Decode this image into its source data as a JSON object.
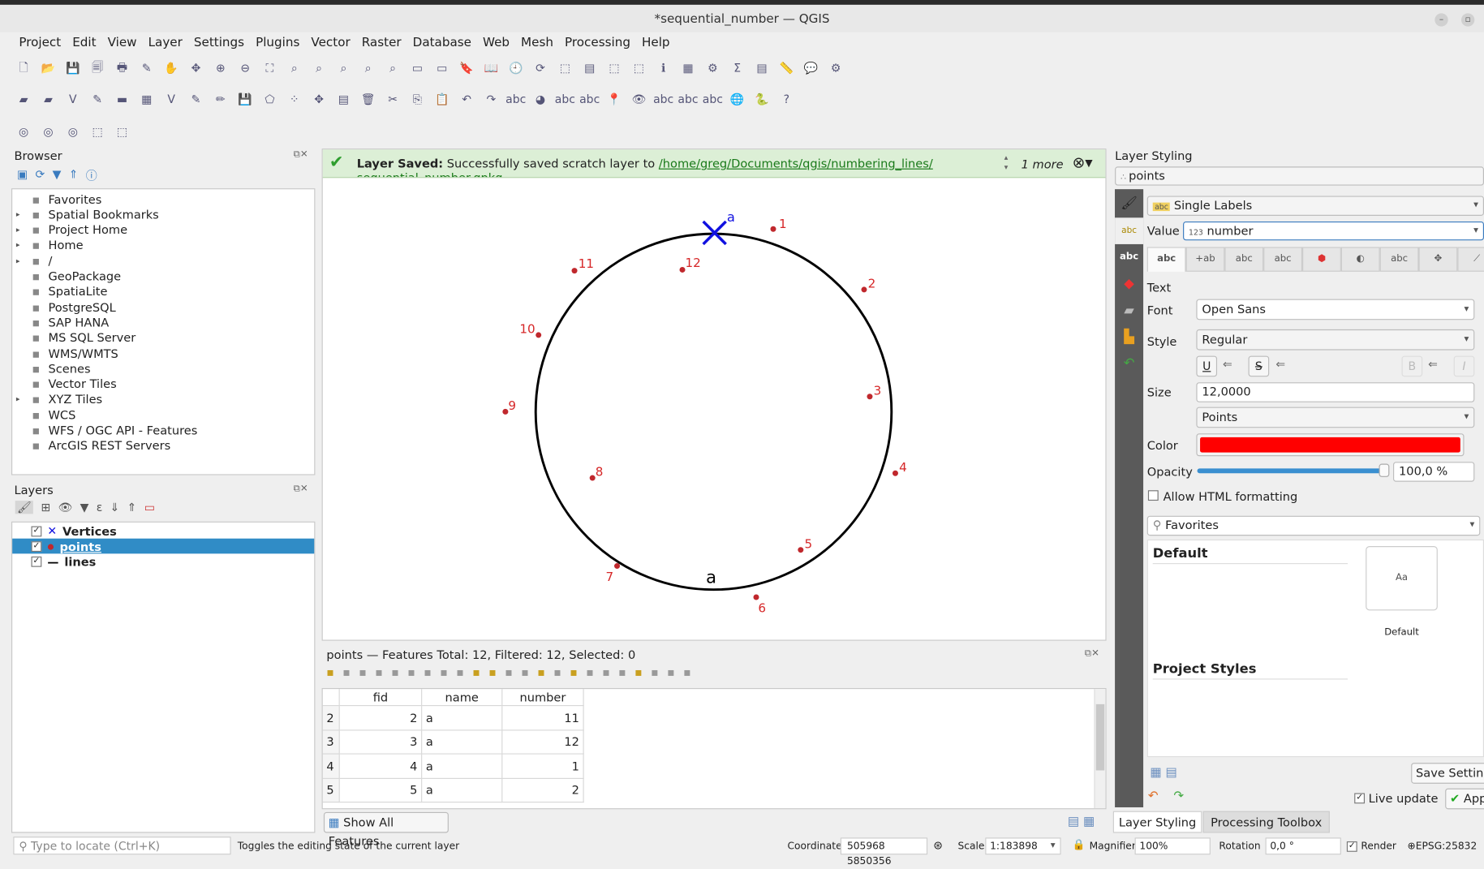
{
  "window": {
    "title": "*sequential_number — QGIS"
  },
  "menu": [
    "Project",
    "Edit",
    "View",
    "Layer",
    "Settings",
    "Plugins",
    "Vector",
    "Raster",
    "Database",
    "Web",
    "Mesh",
    "Processing",
    "Help"
  ],
  "browser": {
    "title": "Browser",
    "items": [
      {
        "label": "Favorites",
        "icon": "star-icon",
        "expandable": false
      },
      {
        "label": "Spatial Bookmarks",
        "icon": "bookmark-icon",
        "expandable": true
      },
      {
        "label": "Project Home",
        "icon": "folder-icon",
        "expandable": true
      },
      {
        "label": "Home",
        "icon": "home-icon",
        "expandable": true
      },
      {
        "label": "/",
        "icon": "folder-icon",
        "expandable": true
      },
      {
        "label": "GeoPackage",
        "icon": "geopackage-icon",
        "expandable": false
      },
      {
        "label": "SpatiaLite",
        "icon": "spatialite-icon",
        "expandable": false
      },
      {
        "label": "PostgreSQL",
        "icon": "postgresql-icon",
        "expandable": false
      },
      {
        "label": "SAP HANA",
        "icon": "hana-icon",
        "expandable": false
      },
      {
        "label": "MS SQL Server",
        "icon": "mssql-icon",
        "expandable": false
      },
      {
        "label": "WMS/WMTS",
        "icon": "globe-icon",
        "expandable": false
      },
      {
        "label": "Scenes",
        "icon": "scenes-icon",
        "expandable": false
      },
      {
        "label": "Vector Tiles",
        "icon": "grid-icon",
        "expandable": false
      },
      {
        "label": "XYZ Tiles",
        "icon": "grid-icon",
        "expandable": true
      },
      {
        "label": "WCS",
        "icon": "globe-icon",
        "expandable": false
      },
      {
        "label": "WFS / OGC API - Features",
        "icon": "globe-icon",
        "expandable": false
      },
      {
        "label": "ArcGIS REST Servers",
        "icon": "globe-icon",
        "expandable": false
      }
    ]
  },
  "layers": {
    "title": "Layers",
    "items": [
      {
        "label": "Vertices",
        "checked": true,
        "selected": false
      },
      {
        "label": "points",
        "checked": true,
        "selected": true
      },
      {
        "label": "lines",
        "checked": true,
        "selected": false
      }
    ]
  },
  "message": {
    "title": "Layer Saved:",
    "text": "Successfully saved scratch layer to",
    "link": "/home/greg/Documents/qgis/numbering_lines/",
    "link2": "sequential_number.gpkg",
    "more": "1 more"
  },
  "map": {
    "point_labels": [
      "1",
      "2",
      "3",
      "4",
      "5",
      "6",
      "7",
      "8",
      "9",
      "10",
      "11",
      "12"
    ],
    "vertex_label": "a",
    "line_label": "a",
    "point_color": "#c0282d",
    "label_color": "#d62728",
    "vertex_color": "#1010e0"
  },
  "attr_table": {
    "title": "points — Features Total: 12, Filtered: 12, Selected: 0",
    "columns": [
      "fid",
      "name",
      "number"
    ],
    "rows": [
      {
        "row": "2",
        "fid": "2",
        "name": "a",
        "number": "11"
      },
      {
        "row": "3",
        "fid": "3",
        "name": "a",
        "number": "12"
      },
      {
        "row": "4",
        "fid": "4",
        "name": "a",
        "number": "1"
      },
      {
        "row": "5",
        "fid": "5",
        "name": "a",
        "number": "2"
      }
    ],
    "show_all": "Show All Features"
  },
  "styling": {
    "title": "Layer Styling",
    "layer": "points",
    "renderer": "Single Labels",
    "value_label": "Value",
    "value": "number",
    "value_type": "123",
    "section": "Text",
    "font_label": "Font",
    "font": "Open Sans",
    "style_label": "Style",
    "style": "Regular",
    "size_label": "Size",
    "size": "12,0000",
    "unit": "Points",
    "color_label": "Color",
    "color": "#ff0000",
    "opacity_label": "Opacity",
    "opacity": "100,0 %",
    "opacity_pct": 100,
    "html_label": "Allow HTML formatting",
    "html_checked": false,
    "search": "Favorites",
    "default_h": "Default",
    "preview": "Aa",
    "preview_name": "Default",
    "project_h": "Project Styles",
    "save": "Save Setting",
    "live": "Live update",
    "live_checked": true,
    "apply": "App",
    "tabs": [
      "Layer Styling",
      "Processing Toolbox"
    ]
  },
  "status": {
    "locate_placeholder": "Type to locate (Ctrl+K)",
    "hint": "Toggles the editing state of the current layer",
    "coord_label": "Coordinate",
    "coord": "505968  5850356",
    "scale_label": "Scale",
    "scale": "1:183898",
    "mag_label": "Magnifier",
    "mag": "100%",
    "rot_label": "Rotation",
    "rot": "0,0 °",
    "render": "Render",
    "crs": "EPSG:25832"
  }
}
